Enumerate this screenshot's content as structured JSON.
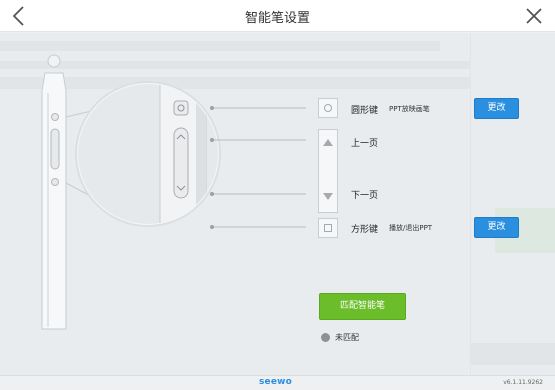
{
  "window": {
    "title": "智能笔设置"
  },
  "pen_buttons": {
    "round": {
      "label": "圆形键",
      "function": "PPT放映画笔",
      "change_label": "更改"
    },
    "page_up": {
      "label": "上一页"
    },
    "page_down": {
      "label": "下一页"
    },
    "square": {
      "label": "方形键",
      "function": "播放/退出PPT",
      "change_label": "更改"
    }
  },
  "pairing": {
    "button_label": "匹配智能笔",
    "status": "未匹配"
  },
  "footer": {
    "logo": "seewo",
    "version": "v6.1.11.9262"
  },
  "colors": {
    "accent_blue": "#2b8fe0",
    "pair_green": "#6bbd2a",
    "status_grey": "#8d9196"
  },
  "icons": [
    "back-arrow-icon",
    "close-icon",
    "circle-icon",
    "triangle-up-icon",
    "triangle-down-icon",
    "square-icon"
  ]
}
